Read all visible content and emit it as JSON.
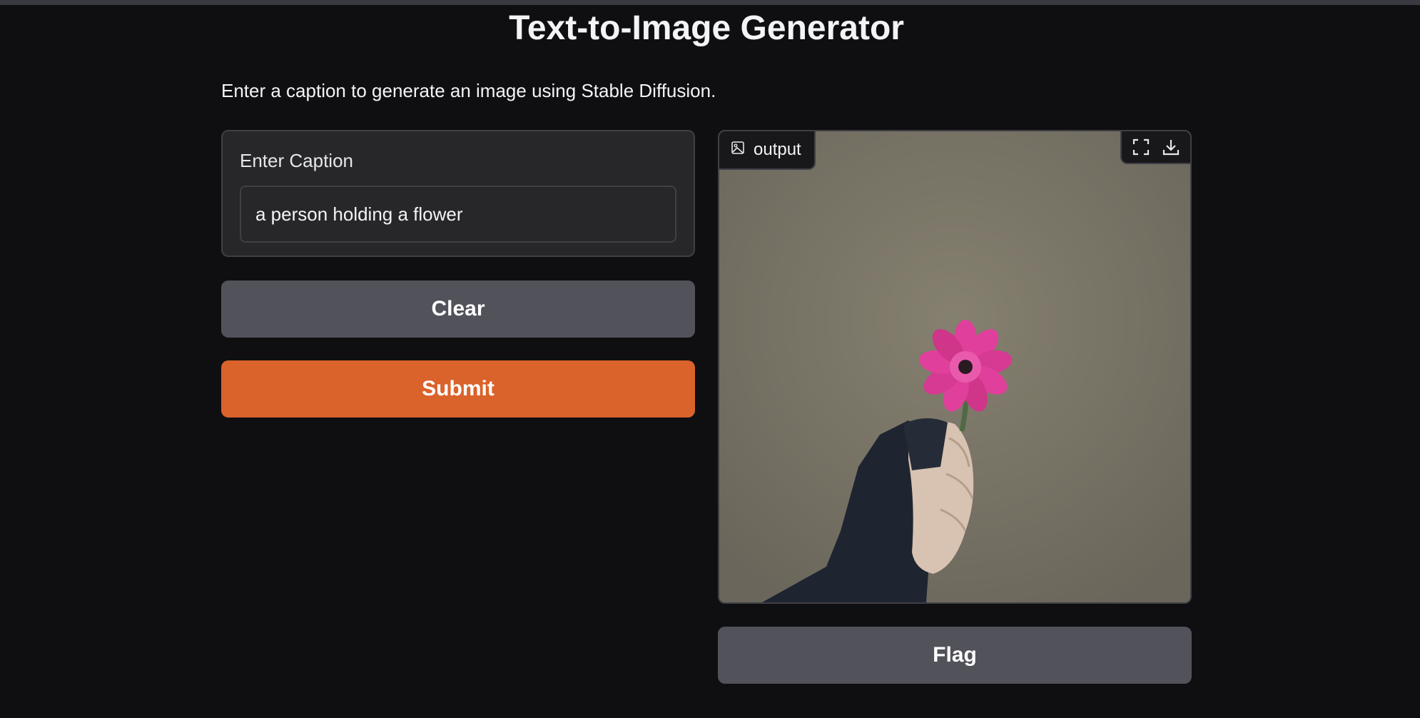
{
  "header": {
    "title": "Text-to-Image Generator",
    "description": "Enter a caption to generate an image using Stable Diffusion."
  },
  "input": {
    "label": "Enter Caption",
    "value": "a person holding a flower"
  },
  "buttons": {
    "clear": "Clear",
    "submit": "Submit",
    "flag": "Flag"
  },
  "output": {
    "label": "output",
    "label_icon": "image-icon",
    "tools": [
      "fullscreen-icon",
      "download-icon"
    ]
  },
  "colors": {
    "background": "#0f0f11",
    "panel": "#27272a",
    "secondary_button": "#52525b",
    "primary_button": "#da622b"
  }
}
